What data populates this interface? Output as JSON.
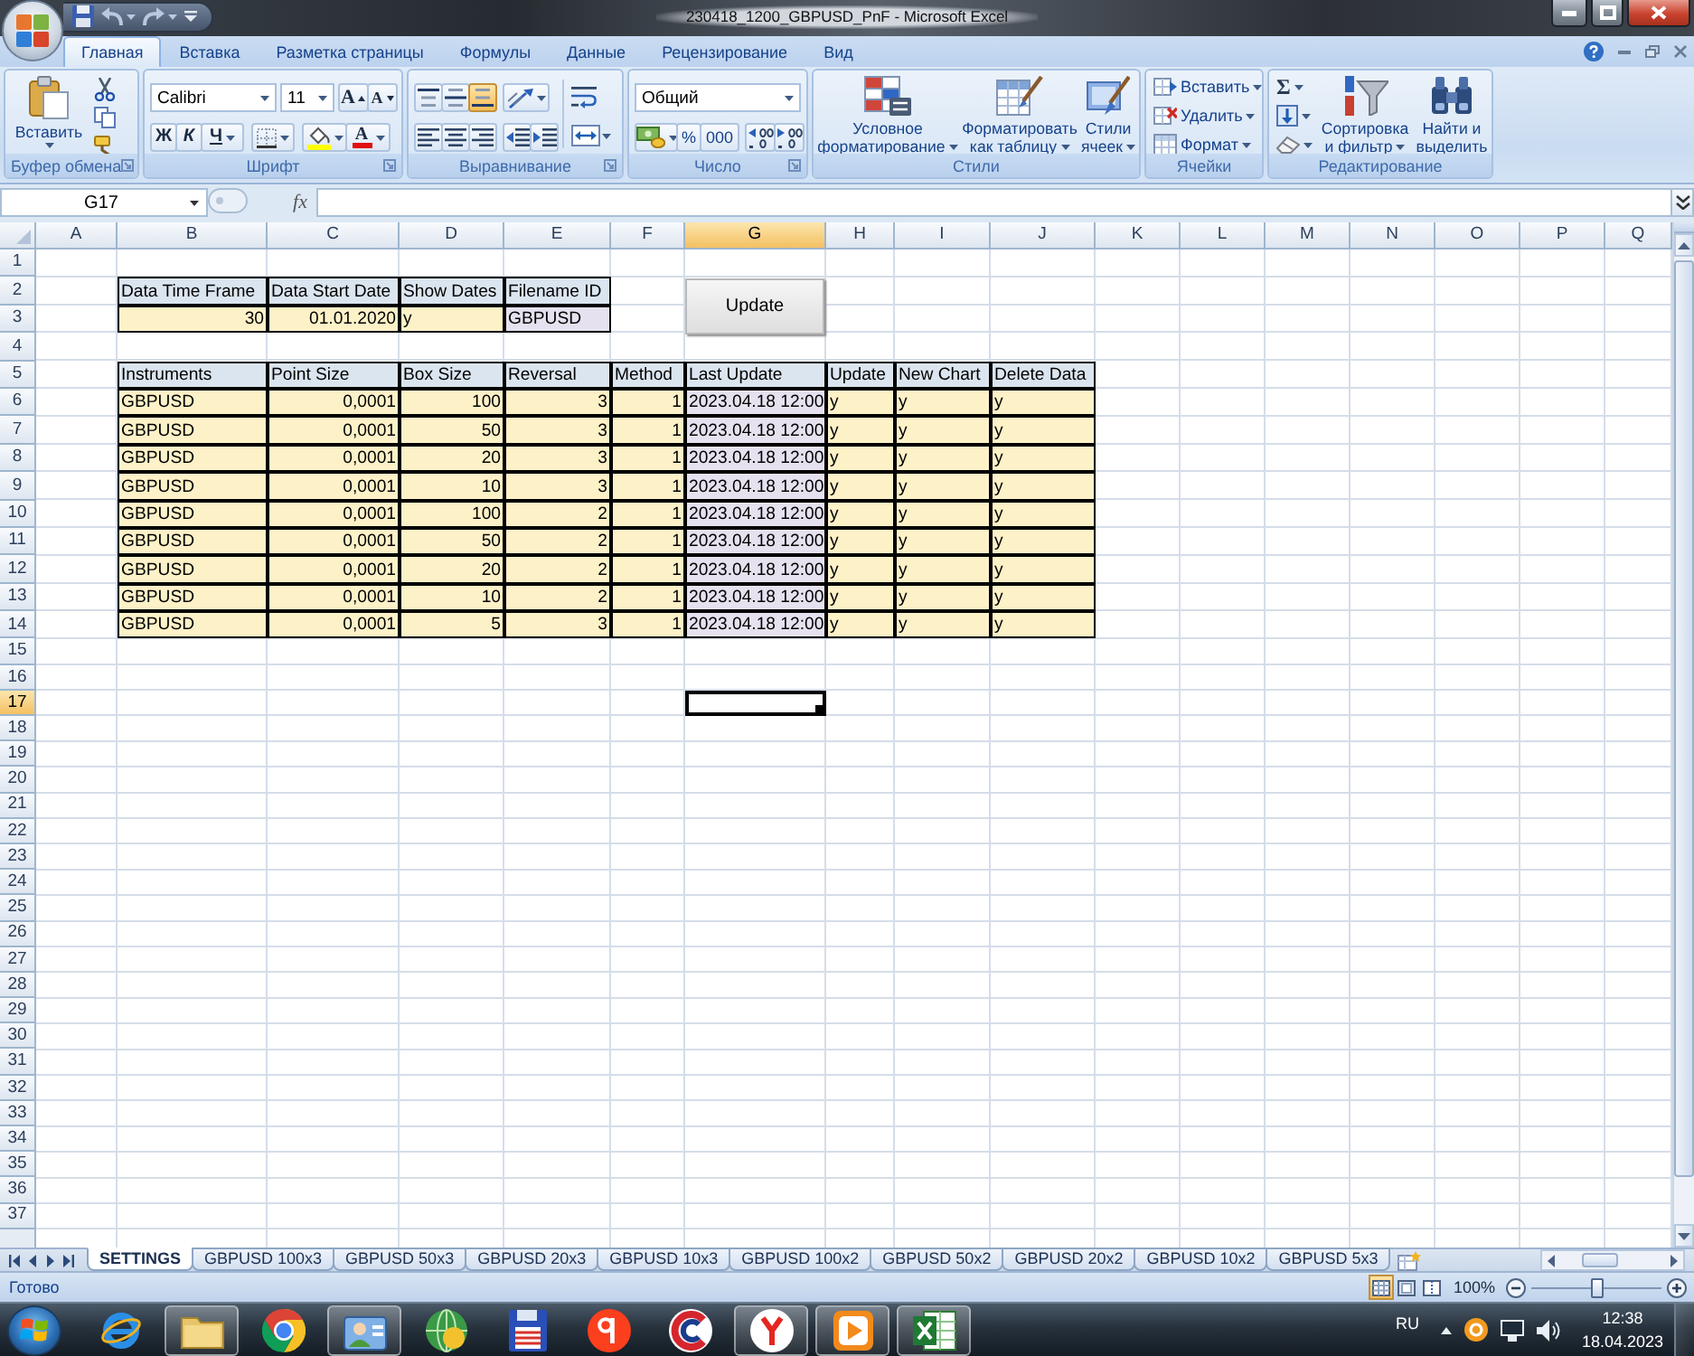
{
  "window": {
    "title": "230418_1200_GBPUSD_PnF - Microsoft Excel"
  },
  "ribbon": {
    "tabs": [
      {
        "label": "Главная",
        "selected": true
      },
      {
        "label": "Вставка",
        "selected": false
      },
      {
        "label": "Разметка страницы",
        "selected": false
      },
      {
        "label": "Формулы",
        "selected": false
      },
      {
        "label": "Данные",
        "selected": false
      },
      {
        "label": "Рецензирование",
        "selected": false
      },
      {
        "label": "Вид",
        "selected": false
      }
    ],
    "clipboard": {
      "label": "Буфер обмена",
      "paste": "Вставить"
    },
    "font": {
      "label": "Шрифт",
      "name": "Calibri",
      "size": "11",
      "grow": "A",
      "shrink": "A",
      "bold": "Ж",
      "italic": "К",
      "underline": "Ч",
      "color_button": "A"
    },
    "alignment": {
      "label": "Выравнивание",
      "vertical": [
        {
          "selected": false
        },
        {
          "selected": false
        },
        {
          "selected": true
        }
      ]
    },
    "number": {
      "label": "Число",
      "format": "Общий",
      "percent": "%",
      "thousands": "000"
    },
    "styles": {
      "label": "Стили",
      "buttons": [
        {
          "kind": "conditional",
          "label": "Условное форматирование"
        },
        {
          "kind": "table",
          "label": "Форматировать как таблицу"
        },
        {
          "kind": "cellstyles",
          "label": "Стили ячеек"
        }
      ]
    },
    "cells": {
      "label": "Ячейки",
      "buttons": [
        {
          "kind": "insert",
          "label": "Вставить"
        },
        {
          "kind": "delete",
          "label": "Удалить"
        },
        {
          "kind": "format",
          "label": "Формат"
        }
      ]
    },
    "editing": {
      "label": "Редактирование",
      "sum": "Σ",
      "buttons": [
        {
          "kind": "sort",
          "label": "Сортировка и фильтр"
        },
        {
          "kind": "find",
          "label": "Найти и выделить"
        }
      ]
    }
  },
  "formula_bar": {
    "name_box": "G17",
    "function_button": "fx"
  },
  "sheet": {
    "columns": [
      {
        "label": "A",
        "selected": false
      },
      {
        "label": "B",
        "selected": false
      },
      {
        "label": "C",
        "selected": false
      },
      {
        "label": "D",
        "selected": false
      },
      {
        "label": "E",
        "selected": false
      },
      {
        "label": "F",
        "selected": false
      },
      {
        "label": "G",
        "selected": true
      },
      {
        "label": "H",
        "selected": false
      },
      {
        "label": "I",
        "selected": false
      },
      {
        "label": "J",
        "selected": false
      },
      {
        "label": "K",
        "selected": false
      },
      {
        "label": "L",
        "selected": false
      },
      {
        "label": "M",
        "selected": false
      },
      {
        "label": "N",
        "selected": false
      },
      {
        "label": "O",
        "selected": false
      },
      {
        "label": "P",
        "selected": false
      },
      {
        "label": "Q",
        "selected": false
      }
    ],
    "rows": [
      {
        "label": "1",
        "selected": false
      },
      {
        "label": "2",
        "selected": false
      },
      {
        "label": "3",
        "selected": false
      },
      {
        "label": "4",
        "selected": false
      },
      {
        "label": "5",
        "selected": false
      },
      {
        "label": "6",
        "selected": false
      },
      {
        "label": "7",
        "selected": false
      },
      {
        "label": "8",
        "selected": false
      },
      {
        "label": "9",
        "selected": false
      },
      {
        "label": "10",
        "selected": false
      },
      {
        "label": "11",
        "selected": false
      },
      {
        "label": "12",
        "selected": false
      },
      {
        "label": "13",
        "selected": false
      },
      {
        "label": "14",
        "selected": false
      },
      {
        "label": "15",
        "selected": false
      },
      {
        "label": "16",
        "selected": false
      },
      {
        "label": "17",
        "selected": true
      },
      {
        "label": "18",
        "selected": false
      },
      {
        "label": "19",
        "selected": false
      },
      {
        "label": "20",
        "selected": false
      },
      {
        "label": "21",
        "selected": false
      },
      {
        "label": "22",
        "selected": false
      },
      {
        "label": "23",
        "selected": false
      },
      {
        "label": "24",
        "selected": false
      },
      {
        "label": "25",
        "selected": false
      },
      {
        "label": "26",
        "selected": false
      },
      {
        "label": "27",
        "selected": false
      },
      {
        "label": "28",
        "selected": false
      },
      {
        "label": "29",
        "selected": false
      },
      {
        "label": "30",
        "selected": false
      },
      {
        "label": "31",
        "selected": false
      },
      {
        "label": "32",
        "selected": false
      },
      {
        "label": "33",
        "selected": false
      },
      {
        "label": "34",
        "selected": false
      },
      {
        "label": "35",
        "selected": false
      },
      {
        "label": "36",
        "selected": false
      },
      {
        "label": "37",
        "selected": false
      }
    ],
    "settings_table": {
      "headers": [
        "Data Time Frame",
        "Data Start Date",
        "Show Dates",
        "Filename ID"
      ],
      "values": [
        "30",
        "01.01.2020",
        "y",
        "GBPUSD"
      ]
    },
    "instruments_table": {
      "headers": [
        "Instruments",
        "Point Size",
        "Box Size",
        "Reversal",
        "Method",
        "Last Update",
        "Update",
        "New Chart",
        "Delete Data"
      ],
      "rows": [
        [
          "GBPUSD",
          "0,0001",
          "100",
          "3",
          "1",
          "2023.04.18 12:00",
          "y",
          "y",
          "y"
        ],
        [
          "GBPUSD",
          "0,0001",
          "50",
          "3",
          "1",
          "2023.04.18 12:00",
          "y",
          "y",
          "y"
        ],
        [
          "GBPUSD",
          "0,0001",
          "20",
          "3",
          "1",
          "2023.04.18 12:00",
          "y",
          "y",
          "y"
        ],
        [
          "GBPUSD",
          "0,0001",
          "10",
          "3",
          "1",
          "2023.04.18 12:00",
          "y",
          "y",
          "y"
        ],
        [
          "GBPUSD",
          "0,0001",
          "100",
          "2",
          "1",
          "2023.04.18 12:00",
          "y",
          "y",
          "y"
        ],
        [
          "GBPUSD",
          "0,0001",
          "50",
          "2",
          "1",
          "2023.04.18 12:00",
          "y",
          "y",
          "y"
        ],
        [
          "GBPUSD",
          "0,0001",
          "20",
          "2",
          "1",
          "2023.04.18 12:00",
          "y",
          "y",
          "y"
        ],
        [
          "GBPUSD",
          "0,0001",
          "10",
          "2",
          "1",
          "2023.04.18 12:00",
          "y",
          "y",
          "y"
        ],
        [
          "GBPUSD",
          "0,0001",
          "5",
          "3",
          "1",
          "2023.04.18 12:00",
          "y",
          "y",
          "y"
        ]
      ]
    },
    "update_button": "Update"
  },
  "sheet_tabs": [
    {
      "label": "SETTINGS",
      "selected": true
    },
    {
      "label": "GBPUSD 100x3",
      "selected": false
    },
    {
      "label": "GBPUSD 50x3",
      "selected": false
    },
    {
      "label": "GBPUSD 20x3",
      "selected": false
    },
    {
      "label": "GBPUSD 10x3",
      "selected": false
    },
    {
      "label": "GBPUSD 100x2",
      "selected": false
    },
    {
      "label": "GBPUSD 50x2",
      "selected": false
    },
    {
      "label": "GBPUSD 20x2",
      "selected": false
    },
    {
      "label": "GBPUSD 10x2",
      "selected": false
    },
    {
      "label": "GBPUSD 5x3",
      "selected": false
    }
  ],
  "status_bar": {
    "text": "Готово",
    "views": [
      {
        "selected": true
      },
      {
        "selected": false
      },
      {
        "selected": false
      }
    ],
    "zoom": "100%",
    "zoom_slider": {
      "level": 0.5
    }
  },
  "taskbar": {
    "apps": [
      {
        "kind": "ring",
        "running": false
      },
      {
        "kind": "folder",
        "running": true
      },
      {
        "kind": "wheel",
        "running": false
      },
      {
        "kind": "contacts",
        "running": true
      },
      {
        "kind": "globe",
        "running": false
      },
      {
        "kind": "floppy",
        "running": false
      },
      {
        "kind": "redcircle",
        "running": false
      },
      {
        "kind": "openring",
        "running": false
      },
      {
        "kind": "fork",
        "running": true
      },
      {
        "kind": "play",
        "running": true
      },
      {
        "kind": "sheet",
        "running": true
      }
    ],
    "language": "RU",
    "time": "12:38",
    "date": "18.04.2023"
  }
}
